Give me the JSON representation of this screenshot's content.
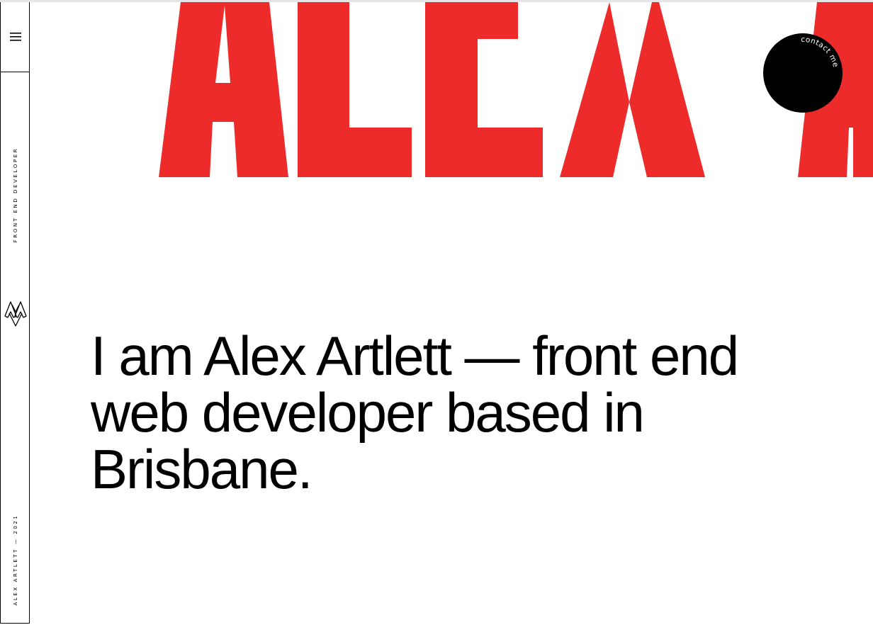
{
  "hero": {
    "headline": "ALEX A",
    "accent_color": "#ED2B2B"
  },
  "sidebar": {
    "menu_icon": "hamburger-icon",
    "role_label": "FRONT END DEVELOPER",
    "footer_label": "ALEX ARTLETT — 2021",
    "logo_icon": "aa-monogram-icon"
  },
  "contact": {
    "label": "contact me",
    "background": "#000000",
    "text_color": "#ffffff"
  },
  "main": {
    "intro": "I am Alex Artlett — front end web developer based in Brisbane."
  }
}
